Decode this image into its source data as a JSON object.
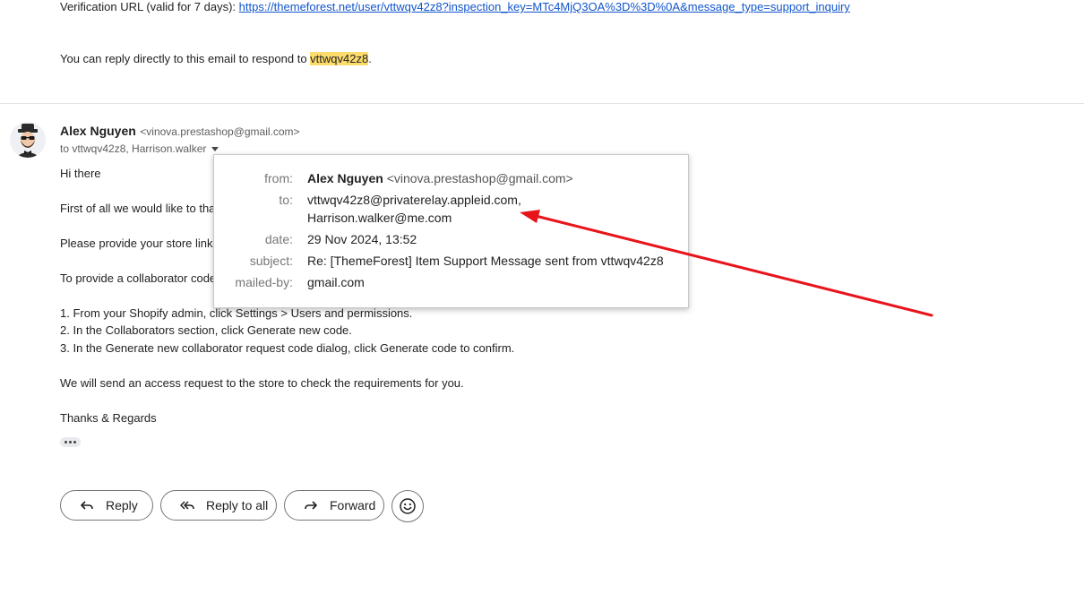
{
  "previous_message": {
    "verification_label": "Verification URL (valid for 7 days): ",
    "verification_url": "https://themeforest.net/user/vttwqv42z8?inspection_key=MTc4MjQ3OA%3D%3D%0A&message_type=support_inquiry",
    "reply_prefix": "You can reply directly to this email to respond to ",
    "reply_username": "vttwqv42z8",
    "reply_suffix": "."
  },
  "message": {
    "sender_name": "Alex Nguyen",
    "sender_email": "<vinova.prestashop@gmail.com>",
    "to_line": "to vttwqv42z8, Harrison.walker",
    "body": {
      "greeting": "Hi there",
      "line1_visible": "First of all we would like to tha",
      "line2_visible": "Please provide your store link",
      "line3_visible": "To provide a collaborator code",
      "step1": "1. From your Shopify admin, click Settings > Users and permissions.",
      "step2": "2. In the Collaborators section, click Generate new code.",
      "step3": "3. In the Generate new collaborator request code dialog, click Generate code to confirm.",
      "closing_info": "We will send an access request to the store to check the requirements for you.",
      "signoff": "Thanks & Regards"
    }
  },
  "details_popup": {
    "from_label": "from:",
    "from_name": "Alex Nguyen",
    "from_email": "<vinova.prestashop@gmail.com>",
    "to_label": "to:",
    "to_value_1": "vttwqv42z8@privaterelay.appleid.com,",
    "to_value_2": "Harrison.walker@me.com",
    "date_label": "date:",
    "date_value": "29 Nov 2024, 13:52",
    "subject_label": "subject:",
    "subject_value": "Re: [ThemeForest] Item Support Message sent from vttwqv42z8",
    "mailed_by_label": "mailed-by:",
    "mailed_by_value": "gmail.com"
  },
  "actions": {
    "reply_label": "Reply",
    "reply_all_label": "Reply to all",
    "forward_label": "Forward"
  },
  "icons": {
    "reply": "reply-icon",
    "reply_all": "reply-all-icon",
    "forward": "forward-icon",
    "emoji": "emoji-icon",
    "more": "more-dots-icon",
    "caret": "chevron-down-icon"
  },
  "colors": {
    "link": "#1155cc",
    "highlight": "#fddc6c",
    "annotation_arrow": "#e8141b"
  }
}
